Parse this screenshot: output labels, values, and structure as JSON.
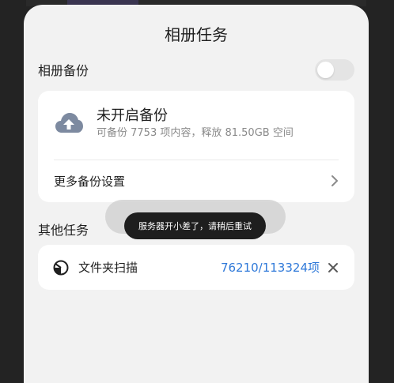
{
  "sheet": {
    "title": "相册任务"
  },
  "album_backup": {
    "label": "相册备份",
    "toggle_on": false
  },
  "backup_card": {
    "icon": "cloud-upload-icon",
    "title": "未开启备份",
    "subtitle": "可备份 7753 项内容，释放 81.50GB 空间",
    "more_settings_label": "更多备份设置"
  },
  "other_tasks": {
    "label": "其他任务",
    "items": [
      {
        "icon": "scan-icon",
        "label": "文件夹扫描",
        "progress": "76210/113324项"
      }
    ]
  },
  "toast": {
    "message": "服务器开小差了，请稍后重试"
  },
  "colors": {
    "accent": "#2f79d9",
    "sheet_bg": "#f2f2f2",
    "card_bg": "#ffffff",
    "toast_bg": "#1e1e1e"
  }
}
